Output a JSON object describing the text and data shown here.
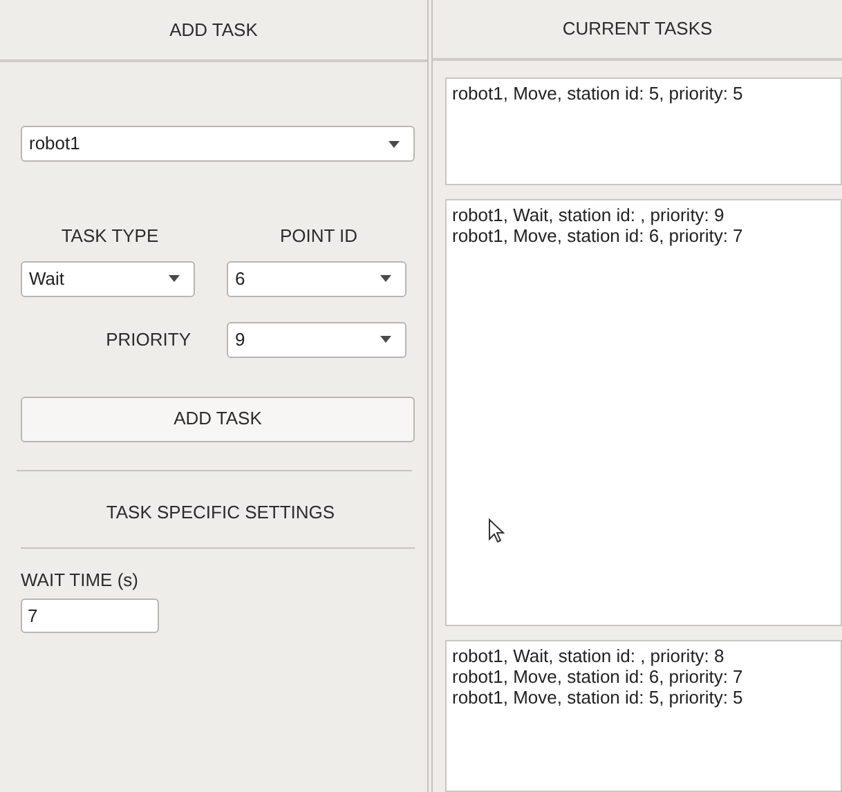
{
  "add_task_panel": {
    "title": "ADD TASK",
    "robot_select": {
      "value": "robot1"
    },
    "task_type": {
      "label": "TASK TYPE",
      "value": "Wait"
    },
    "point_id": {
      "label": "POINT ID",
      "value": "6"
    },
    "priority": {
      "label": "PRIORITY",
      "value": "9"
    },
    "add_button": "ADD TASK",
    "settings_title": "TASK SPECIFIC SETTINGS",
    "wait_time": {
      "label": "WAIT TIME (s)",
      "value": "7"
    }
  },
  "current_tasks_panel": {
    "title": "CURRENT TASKS",
    "lists": [
      {
        "rows": [
          "robot1, Move, station id: 5, priority: 5"
        ]
      },
      {
        "rows": [
          "robot1, Wait, station id: , priority: 9",
          "robot1, Move, station id: 6, priority: 7"
        ]
      },
      {
        "rows": [
          "robot1, Wait, station id: , priority: 8",
          "robot1, Move, station id: 6, priority: 7",
          "robot1, Move, station id: 5, priority: 5"
        ]
      }
    ]
  }
}
